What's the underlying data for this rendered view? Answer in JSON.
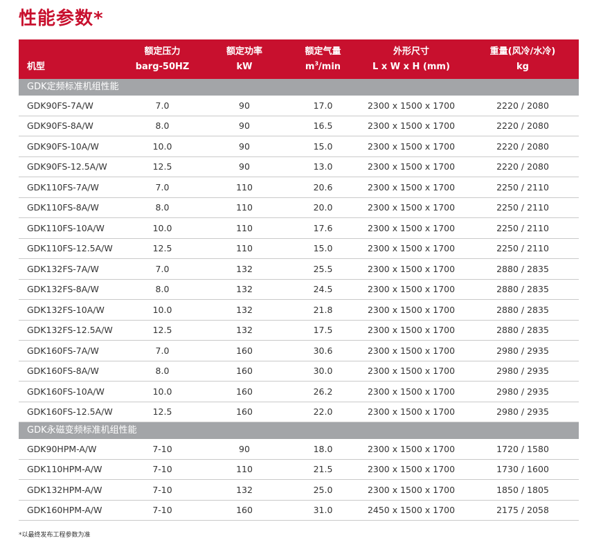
{
  "title": "性能参数*",
  "header": {
    "model": "机型",
    "pressure": "额定压力",
    "pressure_unit": "barg-50HZ",
    "power": "额定功率",
    "power_unit": "kW",
    "flow": "额定气量",
    "flow_unit_base": "m",
    "flow_unit_sup": "3",
    "flow_unit_tail": "/min",
    "dims": "外形尺寸",
    "dims_unit": "L x W x H (mm)",
    "weight": "重量(风冷/水冷)",
    "weight_unit": "kg"
  },
  "section_a": {
    "label": "GDK定频标准机组性能",
    "rows": [
      {
        "model": "GDK90FS-7A/W",
        "pressure": "7.0",
        "power": "90",
        "flow": "17.0",
        "dims": "2300 x 1500 x 1700",
        "weight": "2220 / 2080"
      },
      {
        "model": "GDK90FS-8A/W",
        "pressure": "8.0",
        "power": "90",
        "flow": "16.5",
        "dims": "2300 x 1500 x 1700",
        "weight": "2220 / 2080"
      },
      {
        "model": "GDK90FS-10A/W",
        "pressure": "10.0",
        "power": "90",
        "flow": "15.0",
        "dims": "2300 x 1500 x 1700",
        "weight": "2220 / 2080"
      },
      {
        "model": "GDK90FS-12.5A/W",
        "pressure": "12.5",
        "power": "90",
        "flow": "13.0",
        "dims": "2300 x 1500 x 1700",
        "weight": "2220 / 2080"
      },
      {
        "model": "GDK110FS-7A/W",
        "pressure": "7.0",
        "power": "110",
        "flow": "20.6",
        "dims": "2300 x 1500 x 1700",
        "weight": "2250 / 2110"
      },
      {
        "model": "GDK110FS-8A/W",
        "pressure": "8.0",
        "power": "110",
        "flow": "20.0",
        "dims": "2300 x 1500 x 1700",
        "weight": "2250 / 2110"
      },
      {
        "model": "GDK110FS-10A/W",
        "pressure": "10.0",
        "power": "110",
        "flow": "17.6",
        "dims": "2300 x 1500 x 1700",
        "weight": "2250 / 2110"
      },
      {
        "model": "GDK110FS-12.5A/W",
        "pressure": "12.5",
        "power": "110",
        "flow": "15.0",
        "dims": "2300 x 1500 x 1700",
        "weight": "2250 / 2110"
      },
      {
        "model": "GDK132FS-7A/W",
        "pressure": "7.0",
        "power": "132",
        "flow": "25.5",
        "dims": "2300 x 1500 x 1700",
        "weight": "2880 / 2835"
      },
      {
        "model": "GDK132FS-8A/W",
        "pressure": "8.0",
        "power": "132",
        "flow": "24.5",
        "dims": "2300 x 1500 x 1700",
        "weight": "2880 / 2835"
      },
      {
        "model": "GDK132FS-10A/W",
        "pressure": "10.0",
        "power": "132",
        "flow": "21.8",
        "dims": "2300 x 1500 x 1700",
        "weight": "2880 / 2835"
      },
      {
        "model": "GDK132FS-12.5A/W",
        "pressure": "12.5",
        "power": "132",
        "flow": "17.5",
        "dims": "2300 x 1500 x 1700",
        "weight": "2880 / 2835"
      },
      {
        "model": "GDK160FS-7A/W",
        "pressure": "7.0",
        "power": "160",
        "flow": "30.6",
        "dims": "2300 x 1500 x 1700",
        "weight": "2980 / 2935"
      },
      {
        "model": "GDK160FS-8A/W",
        "pressure": "8.0",
        "power": "160",
        "flow": "30.0",
        "dims": "2300 x 1500 x 1700",
        "weight": "2980 / 2935"
      },
      {
        "model": "GDK160FS-10A/W",
        "pressure": "10.0",
        "power": "160",
        "flow": "26.2",
        "dims": "2300 x 1500 x 1700",
        "weight": "2980 / 2935"
      },
      {
        "model": "GDK160FS-12.5A/W",
        "pressure": "12.5",
        "power": "160",
        "flow": "22.0",
        "dims": "2300 x 1500 x 1700",
        "weight": "2980 / 2935"
      }
    ]
  },
  "section_b": {
    "label": "GDK永磁变频标准机组性能",
    "rows": [
      {
        "model": "GDK90HPM-A/W",
        "pressure": "7-10",
        "power": "90",
        "flow": "18.0",
        "dims": "2300 x 1500 x 1700",
        "weight": "1720 / 1580"
      },
      {
        "model": "GDK110HPM-A/W",
        "pressure": "7-10",
        "power": "110",
        "flow": "21.5",
        "dims": "2300 x 1500 x 1700",
        "weight": "1730 / 1600"
      },
      {
        "model": "GDK132HPM-A/W",
        "pressure": "7-10",
        "power": "132",
        "flow": "25.0",
        "dims": "2300 x 1500 x 1700",
        "weight": "1850 / 1805"
      },
      {
        "model": "GDK160HPM-A/W",
        "pressure": "7-10",
        "power": "160",
        "flow": "31.0",
        "dims": "2450 x 1500 x 1700",
        "weight": "2175 / 2058"
      }
    ]
  },
  "footnote": "*以最终发布工程参数为准",
  "colors": {
    "accent": "#c8102e",
    "section_bg": "#a3a5a8"
  }
}
